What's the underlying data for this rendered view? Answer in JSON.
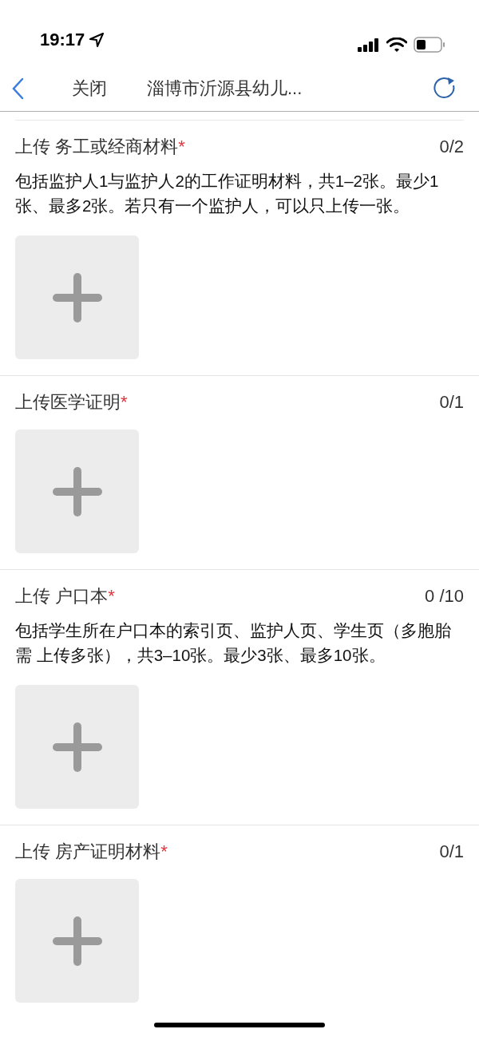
{
  "status_bar": {
    "time": "19:17"
  },
  "nav": {
    "close": "关闭",
    "title": "淄博市沂源县幼儿..."
  },
  "sections": [
    {
      "title": "上传 务工或经商材料",
      "required_mark": "*",
      "count": "0/2",
      "description": "包括监护人1与监护人2的工作证明材料，共1–2张。最少1张、最多2张。若只有一个监护人，可以只上传一张。"
    },
    {
      "title": "上传医学证明",
      "required_mark": "*",
      "count": "0/1"
    },
    {
      "title": "上传 户口本",
      "required_mark": "*",
      "count": "0 /10",
      "description": "包括学生所在户口本的索引页、监护人页、学生页（多胞胎需 上传多张），共3–10张。最少3张、最多10张。"
    },
    {
      "title": "上传 房产证明材料",
      "required_mark": "*",
      "count": "0/1"
    }
  ]
}
